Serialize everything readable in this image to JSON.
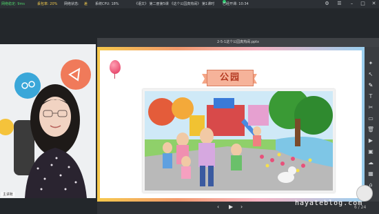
{
  "topbar": {
    "net_label": "网络稳定: 9ms",
    "drop_label": "丢包率: 20%",
    "net_state": "网络状态:",
    "net_state_value": "差",
    "cpu": "系统CPU: 18%",
    "title": "《语文》 第二册第5课 《这个公园真热闹》 第1课时",
    "started": "已经开课: 10:34"
  },
  "camera": {
    "name_label": "主讲账"
  },
  "ppt": {
    "window_title": "2-5-1这个公园真热闹.pptx",
    "slide_title": "公园",
    "page_indicator": "6 / 24"
  },
  "toolbar": [
    "pointer",
    "select",
    "pen",
    "text",
    "shape",
    "eraser",
    "clear",
    "screenshot",
    "media",
    "cloud",
    "box",
    "lock"
  ],
  "watermark": "hayateblog.com",
  "colors": {
    "accent": "#e2315a",
    "title_bg": "#f6b39a",
    "title_fg": "#b43a22",
    "bg": "#23272b"
  }
}
